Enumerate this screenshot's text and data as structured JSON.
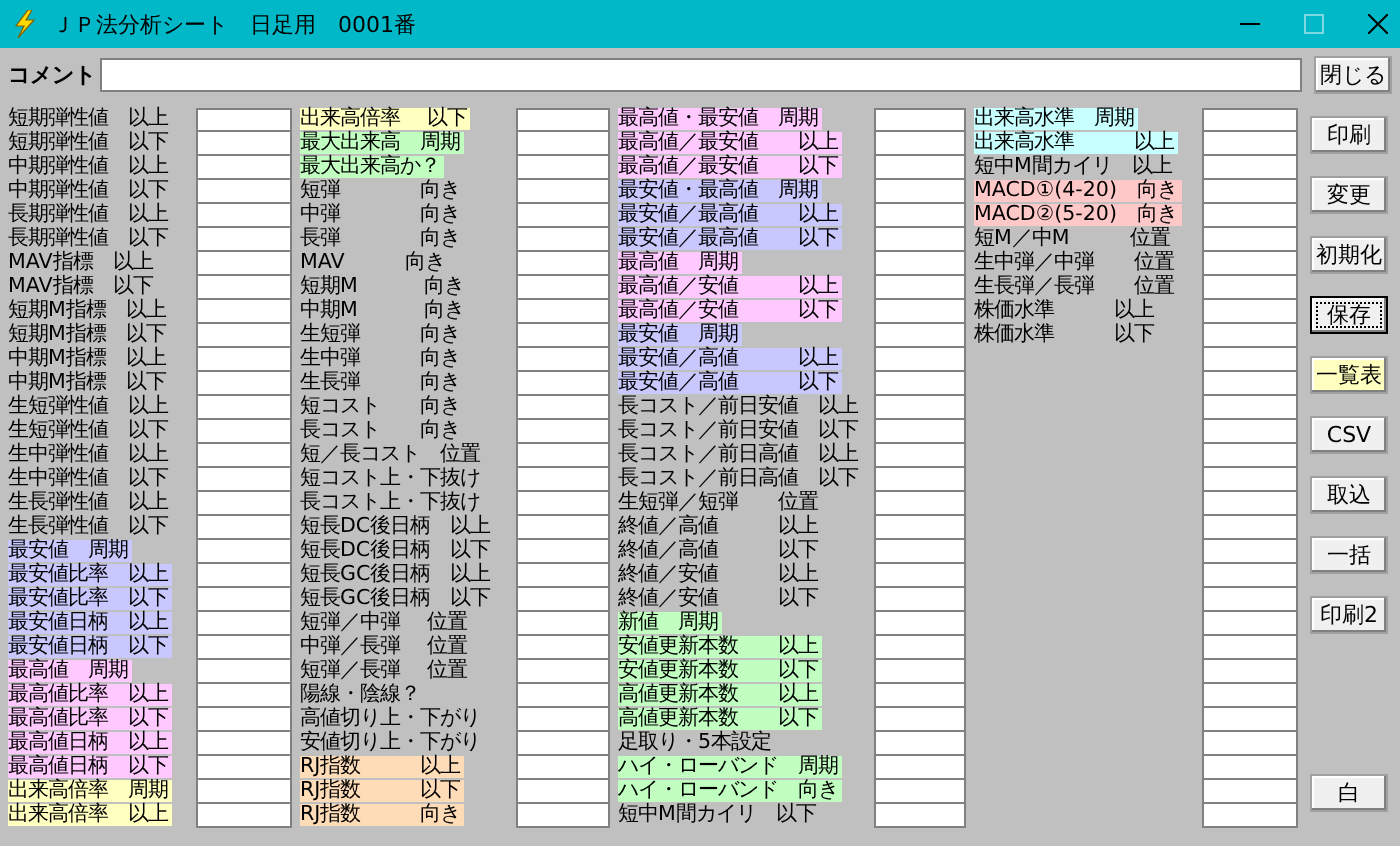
{
  "window": {
    "title": "ＪＰ法分析シート　日足用　0001番"
  },
  "comment": {
    "label": "コメント",
    "button": "閉じる"
  },
  "columns": [
    {
      "rows": [
        {
          "label": "短期弾性値　以上"
        },
        {
          "label": "短期弾性値　以下"
        },
        {
          "label": "中期弾性値　以上"
        },
        {
          "label": "中期弾性値　以下"
        },
        {
          "label": "長期弾性値　以上"
        },
        {
          "label": "長期弾性値　以下"
        },
        {
          "label": "MAV指標　以上"
        },
        {
          "label": "MAV指標　以下"
        },
        {
          "label": "短期M指標　以上"
        },
        {
          "label": "短期M指標　以下"
        },
        {
          "label": "中期M指標　以上"
        },
        {
          "label": "中期M指標　以下"
        },
        {
          "label": "生短弾性値　以上"
        },
        {
          "label": "生短弾性値　以下"
        },
        {
          "label": "生中弾性値　以上"
        },
        {
          "label": "生中弾性値　以下"
        },
        {
          "label": "生長弾性値　以上"
        },
        {
          "label": "生長弾性値　以下"
        },
        {
          "label": "最安値　周期",
          "color": "#c8c8ff"
        },
        {
          "label": "最安値比率　以上",
          "color": "#c8c8ff"
        },
        {
          "label": "最安値比率　以下",
          "color": "#c8c8ff"
        },
        {
          "label": "最安値日柄　以上",
          "color": "#c8c8ff"
        },
        {
          "label": "最安値日柄　以下",
          "color": "#c8c8ff"
        },
        {
          "label": "最高値　周期",
          "color": "#ffc8ff"
        },
        {
          "label": "最高値比率　以上",
          "color": "#ffc8ff"
        },
        {
          "label": "最高値比率　以下",
          "color": "#ffc8ff"
        },
        {
          "label": "最高値日柄　以上",
          "color": "#ffc8ff"
        },
        {
          "label": "最高値日柄　以下",
          "color": "#ffc8ff"
        },
        {
          "label": "出来高倍率　周期",
          "color": "#ffffc0"
        },
        {
          "label": "出来高倍率　以上",
          "color": "#ffffc0"
        }
      ]
    },
    {
      "rows": [
        {
          "label": "出来高倍率　 以下",
          "color": "#ffffc0"
        },
        {
          "label": "最大出来高　周期",
          "color": "#c0ffc0"
        },
        {
          "label": "最大出来高か？",
          "color": "#c0ffc0"
        },
        {
          "label": "短弾　　　　向き"
        },
        {
          "label": "中弾　　　　向き"
        },
        {
          "label": "長弾　　　　向き"
        },
        {
          "label": "MAV　　　向き"
        },
        {
          "label": "短期M　　　 向き"
        },
        {
          "label": "中期M　　　 向き"
        },
        {
          "label": "生短弾　　　向き"
        },
        {
          "label": "生中弾　　　向き"
        },
        {
          "label": "生長弾　　　向き"
        },
        {
          "label": "短コスト　　向き"
        },
        {
          "label": "長コスト　　向き"
        },
        {
          "label": "短／長コスト　位置"
        },
        {
          "label": "短コスト上・下抜け"
        },
        {
          "label": "長コスト上・下抜け"
        },
        {
          "label": "短長DC後日柄　以上"
        },
        {
          "label": "短長DC後日柄　以下"
        },
        {
          "label": "短長GC後日柄　以上"
        },
        {
          "label": "短長GC後日柄　以下"
        },
        {
          "label": "短弾／中弾　 位置"
        },
        {
          "label": "中弾／長弾　 位置"
        },
        {
          "label": "短弾／長弾　 位置"
        },
        {
          "label": "陽線・陰線？"
        },
        {
          "label": "高値切り上・下がり"
        },
        {
          "label": "安値切り上・下がり"
        },
        {
          "label": "RJ指数　　　以上",
          "color": "#ffdcb8"
        },
        {
          "label": "RJ指数　　　以下",
          "color": "#ffdcb8"
        },
        {
          "label": "RJ指数　　　向き",
          "color": "#ffdcb8"
        }
      ]
    },
    {
      "rows": [
        {
          "label": "最高値・最安値　周期",
          "color": "#ffc8ff"
        },
        {
          "label": "最高値／最安値　　以上",
          "color": "#ffc8ff"
        },
        {
          "label": "最高値／最安値　　以下",
          "color": "#ffc8ff"
        },
        {
          "label": "最安値・最高値　周期",
          "color": "#c8c8ff"
        },
        {
          "label": "最安値／最高値　　以上",
          "color": "#c8c8ff"
        },
        {
          "label": "最安値／最高値　　以下",
          "color": "#c8c8ff"
        },
        {
          "label": "最高値　周期",
          "color": "#ffc8ff"
        },
        {
          "label": "最高値／安値　　　以上",
          "color": "#ffc8ff"
        },
        {
          "label": "最高値／安値　　　以下",
          "color": "#ffc8ff"
        },
        {
          "label": "最安値　周期",
          "color": "#c8c8ff"
        },
        {
          "label": "最安値／高値　　　以上",
          "color": "#c8c8ff"
        },
        {
          "label": "最安値／高値　　　以下",
          "color": "#c8c8ff"
        },
        {
          "label": "長コスト／前日安値　以上"
        },
        {
          "label": "長コスト／前日安値　以下"
        },
        {
          "label": "長コスト／前日高値　以上"
        },
        {
          "label": "長コスト／前日高値　以下"
        },
        {
          "label": "生短弾／短弾　　位置"
        },
        {
          "label": "終値／高値　　　以上"
        },
        {
          "label": "終値／高値　　　以下"
        },
        {
          "label": "終値／安値　　　以上"
        },
        {
          "label": "終値／安値　　　以下"
        },
        {
          "label": "新値　周期",
          "color": "#c0ffc0"
        },
        {
          "label": "安値更新本数　　以上",
          "color": "#c0ffc0"
        },
        {
          "label": "安値更新本数　　以下",
          "color": "#c0ffc0"
        },
        {
          "label": "高値更新本数　　以上",
          "color": "#c0ffc0"
        },
        {
          "label": "高値更新本数　　以下",
          "color": "#c0ffc0"
        },
        {
          "label": "足取り・5本設定"
        },
        {
          "label": "ハイ・ローバンド　周期",
          "color": "#c0ffc0"
        },
        {
          "label": "ハイ・ローバンド　向き",
          "color": "#c0ffc0"
        },
        {
          "label": "短中M間カイリ　以下"
        }
      ]
    },
    {
      "rows": [
        {
          "label": "出来高水準　周期",
          "color": "#c8ffff"
        },
        {
          "label": "出来高水準　　　以上",
          "color": "#c8ffff"
        },
        {
          "label": "短中M間カイリ　以上"
        },
        {
          "label": "MACD①(4-20)　向き",
          "color": "#ffc8c8"
        },
        {
          "label": "MACD②(5-20)　向き",
          "color": "#ffc8c8"
        },
        {
          "label": "短M／中M　　　位置"
        },
        {
          "label": "生中弾／中弾　　位置"
        },
        {
          "label": "生長弾／長弾　　位置"
        },
        {
          "label": "株価水準　　　以上"
        },
        {
          "label": "株価水準　　　以下"
        }
      ]
    }
  ],
  "buttons": [
    {
      "label": "印刷",
      "focused": false
    },
    {
      "label": "変更",
      "focused": false
    },
    {
      "label": "初期化",
      "focused": false
    },
    {
      "label": "保存",
      "focused": true
    },
    {
      "label": "一覧表",
      "focused": false,
      "color": "#ffffc0"
    },
    {
      "label": "CSV",
      "focused": false
    },
    {
      "label": "取込",
      "focused": false
    },
    {
      "label": "一括",
      "focused": false
    },
    {
      "label": "印刷2",
      "focused": false
    }
  ],
  "bottom_button": {
    "label": "白"
  }
}
